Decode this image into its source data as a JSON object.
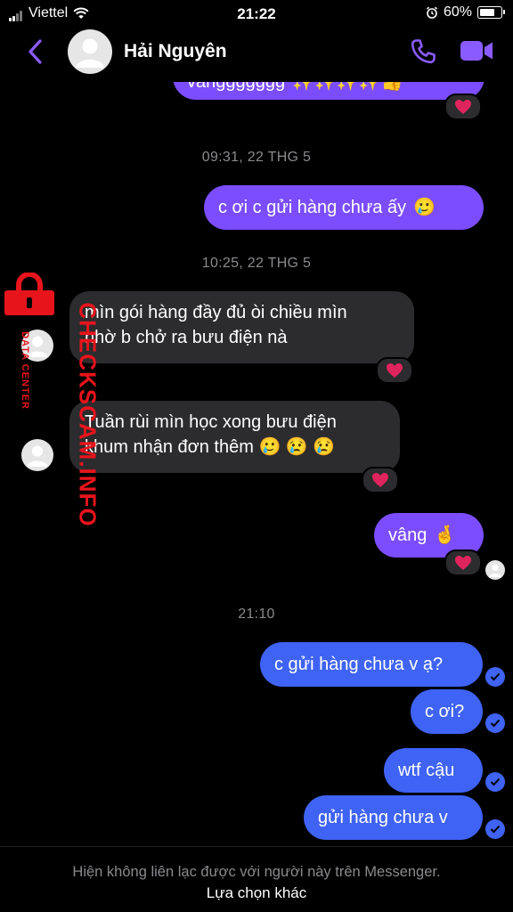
{
  "status_bar": {
    "carrier": "Viettel",
    "time": "21:22",
    "battery": "60%"
  },
  "header": {
    "contact_name": "Hải Nguyên"
  },
  "messages": {
    "partial_top": "vânggggggg",
    "ts1": "09:31, 22 THG 5",
    "m1": "c ơi c gửi hàng chưa ấy",
    "ts2": "10:25, 22 THG 5",
    "m2_line1": "mìn gói hàng đầy đủ òi chiều mìn",
    "m2_line2": "nhờ b chở ra bưu điện nà",
    "m3_line1": "Tuần rùi mìn học xong bưu điện",
    "m3_line2": "khum nhận đơn thêm",
    "m4": "vâng",
    "ts3": "21:10",
    "m5": "c gửi hàng chưa v ạ?",
    "m6": "c ơi?",
    "m7": "wtf cậu",
    "m8": "gửi hàng chưa v"
  },
  "watermark": {
    "brand": "CHECKSCAM.INFO",
    "tagline": "DATA CENTER"
  },
  "footer": {
    "notice": "Hiện không liên lạc được với người này trên Messenger.",
    "action": "Lựa chọn khác"
  },
  "colors": {
    "accent_purple": "#7b4dff",
    "bubble_blue": "#3f63f4",
    "incoming_bubble": "#2c2c2e",
    "heart": "#e0245e",
    "watermark_red": "#e8141c"
  }
}
